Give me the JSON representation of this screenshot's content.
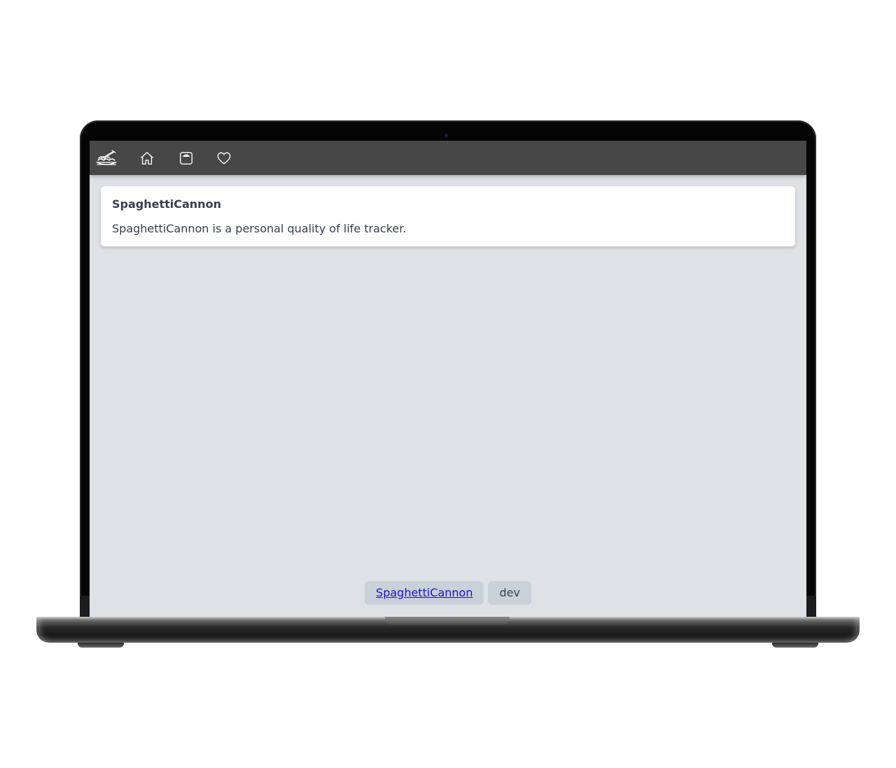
{
  "navbar": {
    "items": [
      {
        "icon": "spaghetti-cannon-logo-icon"
      },
      {
        "icon": "home-icon"
      },
      {
        "icon": "scale-icon"
      },
      {
        "icon": "heart-icon"
      }
    ]
  },
  "card": {
    "title": "SpaghettiCannon",
    "body": "SpaghettiCannon is a personal quality of life tracker."
  },
  "footer": {
    "link_label": "SpaghettiCannon",
    "env_label": "dev"
  },
  "colors": {
    "navbar_bg": "#474747",
    "page_bg": "#dee2e6",
    "card_bg": "#ffffff",
    "text": "#363f4d",
    "pill_bg": "#c9d1d9",
    "link": "#1f0fd6"
  }
}
